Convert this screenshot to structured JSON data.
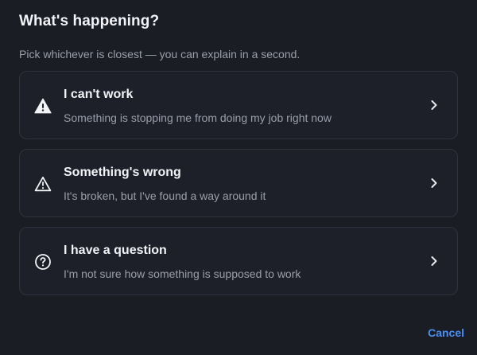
{
  "dialog": {
    "title": "What's happening?",
    "subtitle": "Pick whichever is closest — you can explain in a second.",
    "cancel_label": "Cancel"
  },
  "options": [
    {
      "icon": "warning-filled-icon",
      "title": "I can't work",
      "description": "Something is stopping me from doing my job right now"
    },
    {
      "icon": "warning-outline-icon",
      "title": "Something's wrong",
      "description": "It's broken, but I've found a way around it"
    },
    {
      "icon": "question-circle-icon",
      "title": "I have a question",
      "description": "I'm not sure how something is supposed to work"
    }
  ],
  "colors": {
    "background": "#1b1d25",
    "accent": "#4a8ff0",
    "text_primary": "#f2f3f7",
    "text_secondary": "#9a9eab"
  }
}
